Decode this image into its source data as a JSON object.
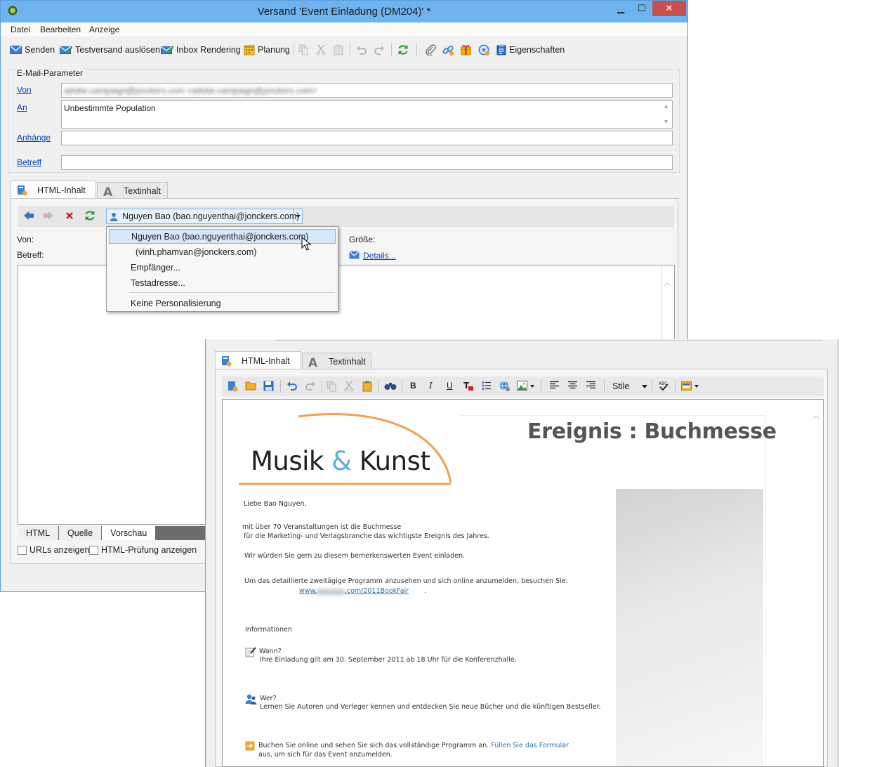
{
  "window1": {
    "title": "Versand 'Event Einladung (DM204)' *",
    "menu": [
      "Datei",
      "Bearbeiten",
      "Anzeige"
    ],
    "toolbar": {
      "send": "Senden",
      "proof": "Testversand auslösen",
      "inbox": "Inbox Rendering",
      "schedule": "Planung",
      "properties": "Eigenschaften"
    },
    "email_params": {
      "legend": "E-Mail-Parameter",
      "from_label": "Von",
      "from_value": "adobe.campaign@jonckers.com <adobe.campaign@jonckers.com>",
      "to_label": "An",
      "to_value": "Unbestimmte Population",
      "attachments_label": "Anhänge",
      "subject_label": "Betreff"
    },
    "tabs": [
      "HTML-Inhalt",
      "Textinhalt"
    ],
    "personalization": {
      "selected": "Nguyen Bao (bao.nguyenthai@jonckers.com)",
      "options": [
        "Nguyen Bao (bao.nguyenthai@jonckers.com)",
        "(vinh.phamvan@jonckers.com)",
        "Empfänger...",
        "Testadresse...",
        "Keine Personalisierung"
      ]
    },
    "preview_header": {
      "from": "Von:",
      "subject": "Betreff:",
      "size": "Größe:",
      "details": "Details..."
    },
    "bottom_tabs": [
      "HTML",
      "Quelle",
      "Vorschau"
    ],
    "checkboxes": [
      "URLs anzeigen",
      "HTML-Prüfung anzeigen"
    ]
  },
  "window2": {
    "tabs": [
      "HTML-Inhalt",
      "Textinhalt"
    ],
    "styles_label": "Stile",
    "email": {
      "headline": "Ereignis : Buchmesse",
      "logo_left": "Musik ",
      "logo_amp": "&",
      "logo_right": " Kunst",
      "greeting": "Liebe Bao Nguyen,",
      "para1_line1": "mit über 70 Veranstaltungen ist die Buchmesse",
      "para1_line2": "für die Marketing- und Verlagsbranche das wichtigste Ereignis des Jahres.",
      "para2": "Wir würden Sie gern zu diesem bemerkenswerten Event einladen.",
      "para3": "Um das detaillierte zweitägige Programm anzusehen und sich online anzumelden, besuchen Sie:",
      "url_prefix": "www.",
      "url_hidden": "xxxxxxx",
      "url_suffix": ".com/2011BookFair",
      "url_end": ".",
      "info_heading": "Informationen",
      "when_label": "Wann?",
      "when_text": "Ihre Einladung gilt am 30. September 2011 ab 18 Uhr für die Konferenzhalle.",
      "who_label": "Wer?",
      "who_text": "Lernen Sie Autoren und Verleger kennen und entdecken Sie neue Bücher und die künftigen Bestseller.",
      "book_text": "Buchen Sie online und sehen Sie sich das vollständige Programm an.",
      "form_link": "Füllen Sie das Formular",
      "book_text2": "aus, um sich für das Event anzumelden."
    }
  },
  "colors": {
    "titlebar": "#6fb3ee",
    "link": "#0645ad",
    "logo_orange": "#f0a050",
    "logo_blue": "#5ab0e0"
  }
}
